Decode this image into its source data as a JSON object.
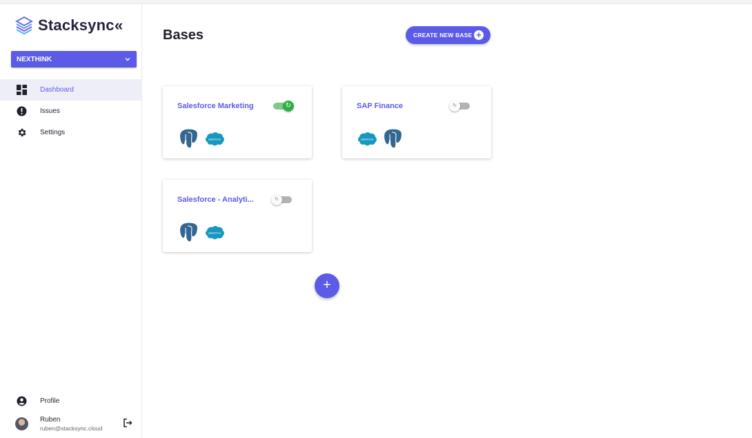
{
  "app": {
    "name": "Stacksync",
    "collapse_symbol": "«"
  },
  "org_select": {
    "value": "NEXTHINK"
  },
  "nav": {
    "items": [
      {
        "label": "Dashboard",
        "icon": "dashboard-icon",
        "active": true
      },
      {
        "label": "Issues",
        "icon": "alert-icon",
        "active": false
      },
      {
        "label": "Settings",
        "icon": "gear-icon",
        "active": false
      }
    ]
  },
  "profile": {
    "label": "Profile"
  },
  "user": {
    "name": "Ruben",
    "email": "ruben@stacksync.cloud"
  },
  "page": {
    "title": "Bases",
    "create_button_label": "CREATE NEW BASE"
  },
  "bases": [
    {
      "title": "Salesforce Marketing",
      "sync_enabled": true,
      "connectors": [
        "postgresql-icon",
        "salesforce-icon"
      ]
    },
    {
      "title": "SAP Finance",
      "sync_enabled": false,
      "connectors": [
        "salesforce-icon",
        "postgresql-icon"
      ]
    },
    {
      "title": "Salesforce - Analyti...",
      "sync_enabled": false,
      "connectors": [
        "postgresql-icon",
        "salesforce-icon"
      ]
    }
  ],
  "fab": {
    "symbol": "+"
  },
  "colors": {
    "accent": "#5b5be8",
    "sync_on": "#2eae45",
    "sync_off": "#b3b3b3",
    "salesforce": "#1798c1",
    "postgres": "#336791"
  }
}
